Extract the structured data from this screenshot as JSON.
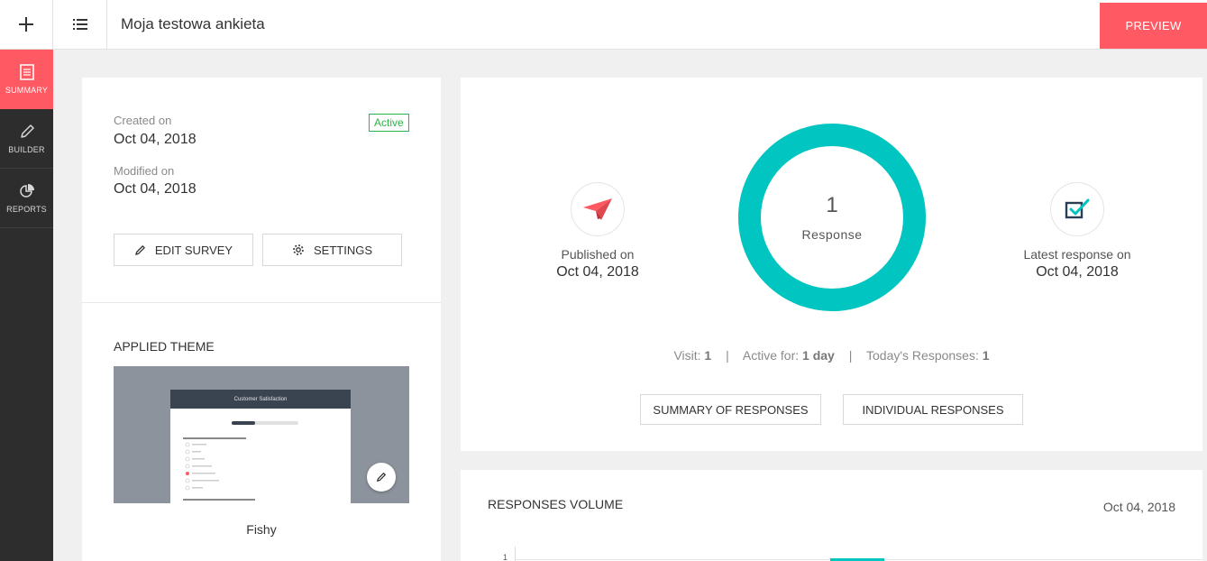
{
  "header": {
    "title": "Moja testowa ankieta",
    "preview_label": "PREVIEW"
  },
  "sidebar": {
    "items": [
      {
        "label": "SUMMARY",
        "icon": "document-icon",
        "active": true
      },
      {
        "label": "BUILDER",
        "icon": "pencil-icon",
        "active": false
      },
      {
        "label": "REPORTS",
        "icon": "pie-chart-icon",
        "active": false
      }
    ]
  },
  "info": {
    "created_label": "Created on",
    "created_value": "Oct 04, 2018",
    "modified_label": "Modified on",
    "modified_value": "Oct 04, 2018",
    "status": "Active",
    "edit_label": "EDIT SURVEY",
    "settings_label": "SETTINGS"
  },
  "theme": {
    "heading": "APPLIED THEME",
    "name": "Fishy",
    "preview_title": "Customer Satisfaction"
  },
  "stats": {
    "published_label": "Published on",
    "published_value": "Oct 04, 2018",
    "responses_count": "1",
    "responses_label": "Response",
    "latest_label": "Latest response on",
    "latest_value": "Oct 04, 2018",
    "visit_label": "Visit:",
    "visit_value": "1",
    "active_label": "Active for:",
    "active_value": "1 day",
    "today_label": "Today's Responses:",
    "today_value": "1",
    "summary_btn": "SUMMARY OF RESPONSES",
    "individual_btn": "INDIVIDUAL RESPONSES",
    "donut_fraction": 1.0
  },
  "volume": {
    "title": "RESPONSES VOLUME",
    "date": "Oct 04, 2018",
    "y_tick": "1"
  },
  "colors": {
    "accent": "#ff5a63",
    "teal": "#00c5c0",
    "active_green": "#2fb34a",
    "sidebar_bg": "#2d2d2d"
  }
}
